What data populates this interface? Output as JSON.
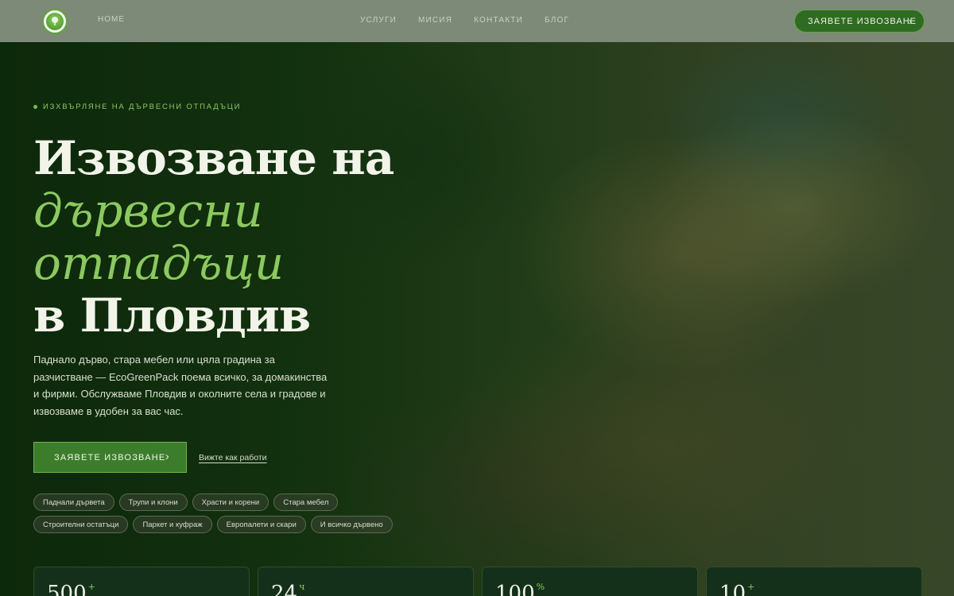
{
  "header": {
    "home_label": "HOME",
    "nav": [
      "УСЛУГИ",
      "МИСИЯ",
      "КОНТАКТИ",
      "БЛОГ"
    ],
    "cta_label": "ЗАЯВЕТЕ ИЗВОЗВАНЕ"
  },
  "hero": {
    "eyebrow": "ИЗХВЪРЛЯНЕ НА ДЪРВЕСНИ ОТПАДЪЦИ",
    "title_line1": "Извозване на",
    "title_line2": "дървесни",
    "title_line3": "отпадъци",
    "title_line4": "в Пловдив",
    "description": "Паднало дърво, стара мебел или цяла градина за разчистване — EcoGreenPack поема всичко, за домакинства и фирми. Обслужваме Пловдив и околните села и градове и извозваме в удобен за вас час.",
    "cta_label": "ЗАЯВЕТЕ ИЗВОЗВАНЕ",
    "secondary_link": "Вижте как работи",
    "tags": [
      "Паднали дървета",
      "Трупи и клони",
      "Храсти и корени",
      "Стара мебел",
      "Строителни остатъци",
      "Паркет и куфраж",
      "Европалети и скари",
      "И всичко дървено"
    ]
  },
  "stats": [
    {
      "number": "500",
      "suffix": "+"
    },
    {
      "number": "24",
      "suffix": "ч"
    },
    {
      "number": "100",
      "suffix": "%"
    },
    {
      "number": "10",
      "suffix": "+"
    }
  ],
  "colors": {
    "accent_green": "#8cc860",
    "button_green": "#3c7d2b",
    "header_bg": "#7d8a78"
  }
}
